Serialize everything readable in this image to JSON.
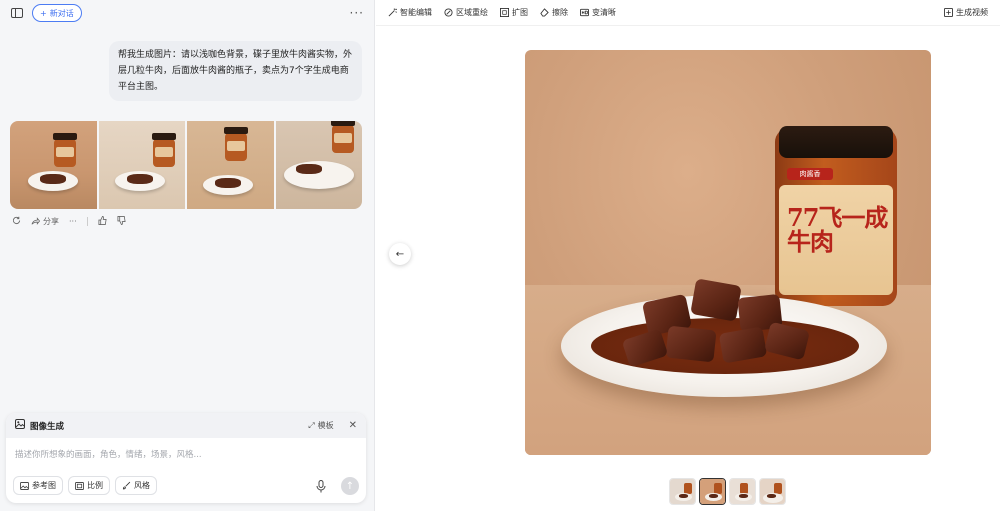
{
  "left": {
    "new_chat_label": "新对话",
    "user_message": "帮我生成图片：请以浅咖色背景，碟子里放牛肉酱实物，外层几粒牛肉，后面放牛肉酱的瓶子，卖点为7个字生成电商平台主图。",
    "actions": {
      "share_label": "分享"
    },
    "composer": {
      "title": "图像生成",
      "template_label": "模板",
      "placeholder": "描述你所想象的画面，角色，情绪，场景，风格...",
      "chips": [
        "参考图",
        "比例",
        "风格"
      ]
    }
  },
  "right": {
    "toolbar": [
      "智能编辑",
      "区域重绘",
      "扩图",
      "擦除",
      "变清晰"
    ],
    "video_label": "生成视频",
    "product_label": {
      "brand": "肉酱香",
      "title": "77飞一成牛肉"
    },
    "thumbnails_count": 4,
    "active_thumbnail": 2
  },
  "colors": {
    "accent": "#3d6ef0",
    "panel_bg": "#f5f6f8",
    "label_red": "#b7241b"
  }
}
